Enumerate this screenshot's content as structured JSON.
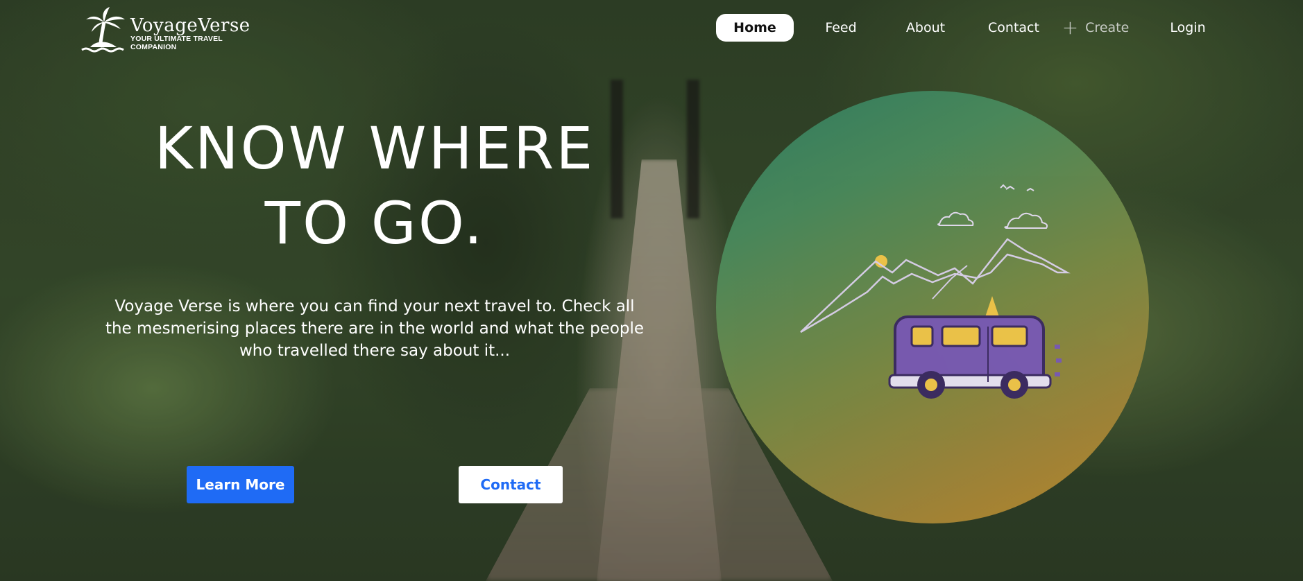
{
  "brand": {
    "name": "VoyageVerse",
    "tagline": "YOUR ULTIMATE TRAVEL COMPANION",
    "logo_icon": "palm-tree-island-icon"
  },
  "nav": {
    "items": [
      {
        "label": "Home",
        "active": true
      },
      {
        "label": "Feed"
      },
      {
        "label": "About"
      },
      {
        "label": "Contact"
      },
      {
        "label": "Create",
        "icon": "plus-icon"
      },
      {
        "label": "Login"
      }
    ]
  },
  "hero": {
    "headline_line1": "KNOW WHERE",
    "headline_line2": "TO GO.",
    "description": "Voyage Verse is where you can find your next travel to. Check all the mesmerising places there are in the world and what the people who travelled there say about it...",
    "primary_button": "Learn More",
    "secondary_button": "Contact"
  },
  "colors": {
    "accent": "#1f6bf5",
    "van": "#7b5bb6",
    "window": "#f4c84a"
  }
}
